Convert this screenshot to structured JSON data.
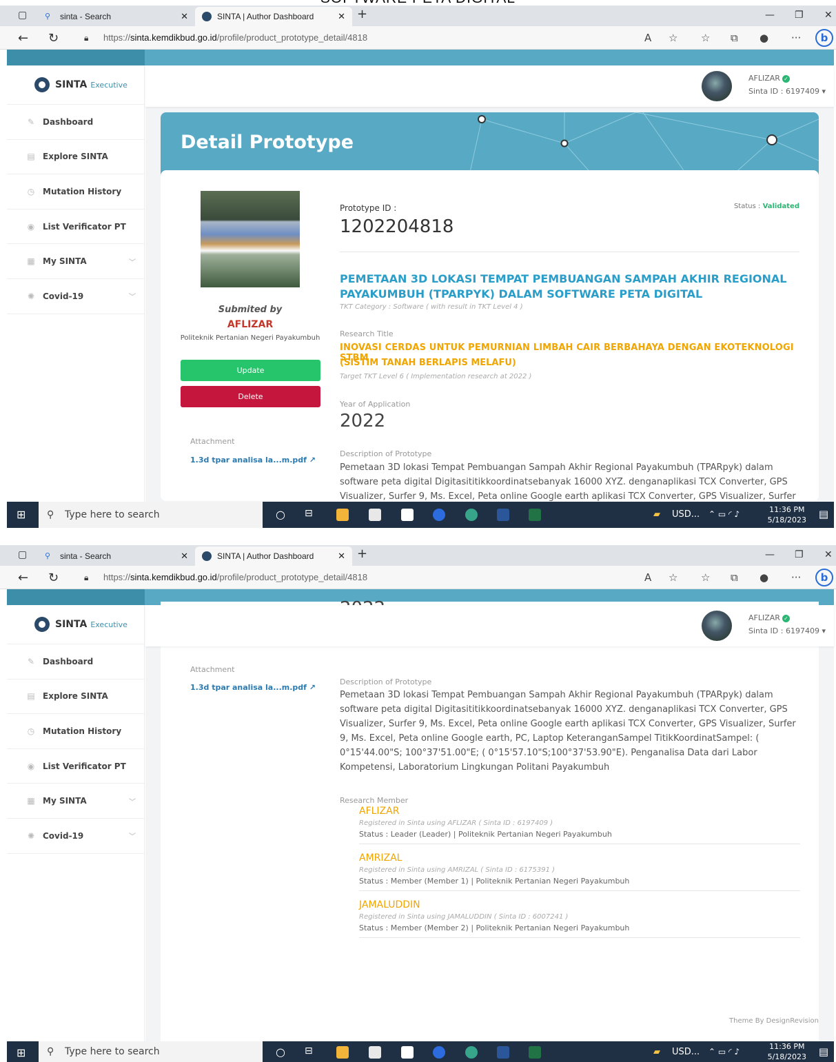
{
  "page_heading": "SOFTWARE PETA DIGITAL",
  "browser": {
    "tabs": [
      {
        "label": "sinta - Search"
      },
      {
        "label": "SINTA | Author Dashboard"
      }
    ],
    "url_prefix": "https://",
    "url_domain": "sinta.kemdikbud.go.id",
    "url_path": "/profile/product_prototype_detail/4818"
  },
  "sidebar": {
    "brand": "SINTA",
    "brand_sub": "Executive",
    "items": [
      {
        "label": "Dashboard"
      },
      {
        "label": "Explore SINTA"
      },
      {
        "label": "Mutation History"
      },
      {
        "label": "List Verificator PT"
      },
      {
        "label": "My SINTA"
      },
      {
        "label": "Covid-19"
      }
    ]
  },
  "user": {
    "name": "AFLIZAR",
    "sinta_id": "Sinta ID : 6197409"
  },
  "page": {
    "title": "Detail Prototype",
    "submitted_by_label": "Submited by",
    "submitter": "AFLIZAR",
    "institution": "Politeknik Pertanian Negeri Payakumbuh",
    "update_label": "Update",
    "delete_label": "Delete",
    "attachment_label": "Attachment",
    "attachment_file": "1.3d tpar analisa la...m.pdf",
    "prototype_id_label": "Prototype ID :",
    "prototype_id": "1202204818",
    "status_label": "Status :",
    "status_value": "Validated",
    "title_line1": "PEMETAAN 3D LOKASI TEMPAT PEMBUANGAN SAMPAH AKHIR REGIONAL",
    "title_line2": "PAYAKUMBUH (TPARPYK) DALAM SOFTWARE PETA DIGITAL",
    "tkt_category": "TKT Category : Software ( with result in TKT Level  4 )",
    "research_title_label": "Research Title",
    "research_title_line1": "INOVASI CERDAS UNTUK PEMURNIAN LIMBAH CAIR BERBAHAYA DENGAN EKOTEKNOLOGI STBM",
    "research_title_line2": "(SISTIM TANAH BERLAPIS MELAFU)",
    "target_tkt": "Target TKT Level 6 ( Implementation research at  2022 )",
    "year_label": "Year of Application",
    "year": "2022",
    "description_label": "Description of Prototype",
    "description": "Pemetaan 3D lokasi Tempat Pembuangan Sampah Akhir Regional Payakumbuh (TPARpyk) dalam software peta digital Digitasititikkoordinatsebanyak 16000 XYZ. denganaplikasi TCX Converter, GPS Visualizer, Surfer 9, Ms. Excel, Peta online Google earth aplikasi TCX Converter, GPS Visualizer, Surfer 9, Ms. Excel, Peta online Google earth, PC, Laptop KeteranganSampel TitikKoordinatSampel: ( 0°15'44.00\"S; 100°37'51.00\"E; ( 0°15'57.10\"S;100°37'53.90\"E). Penganalisa Data dari Labor Kompetensi, Laboratorium Lingkungan Politani Payakumbuh",
    "research_member_label": "Research Member",
    "members": [
      {
        "name": "AFLIZAR",
        "registered": "Registered in Sinta using AFLIZAR ( Sinta ID : 6197409 )",
        "status": "Status : Leader (Leader)   |  Politeknik Pertanian Negeri Payakumbuh"
      },
      {
        "name": "AMRIZAL",
        "registered": "Registered in Sinta using AMRIZAL ( Sinta ID : 6175391 )",
        "status": "Status : Member (Member 1)   |  Politeknik Pertanian Negeri Payakumbuh"
      },
      {
        "name": "JAMALUDDIN",
        "registered": "Registered in Sinta using JAMALUDDIN ( Sinta ID : 6007241 )",
        "status": "Status : Member (Member 2)   |  Politeknik Pertanian Negeri Payakumbuh"
      }
    ],
    "footer": "Theme By DesignRevision"
  },
  "taskbar": {
    "search_placeholder": "Type here to search",
    "currency": "USD...",
    "time": "11:36 PM",
    "date": "5/18/2023"
  }
}
